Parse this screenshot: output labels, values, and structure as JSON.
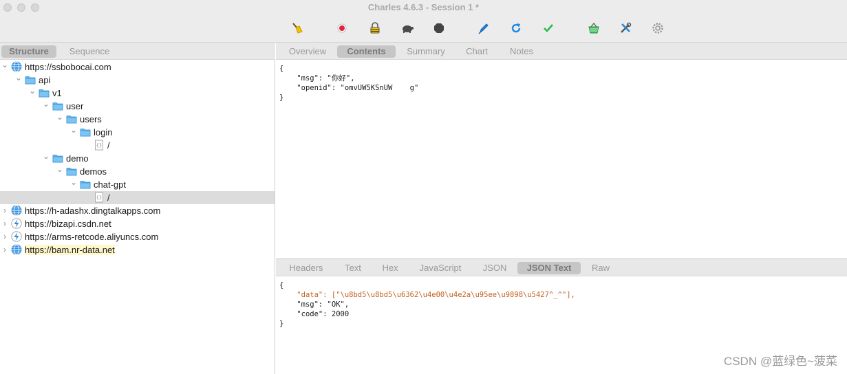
{
  "window": {
    "title": "Charles 4.6.3 - Session 1 *"
  },
  "toolbar": {
    "icons": [
      "broom-icon",
      "record-icon",
      "lock-icon",
      "turtle-icon",
      "stop-icon",
      "pen-icon",
      "refresh-icon",
      "check-icon",
      "basket-icon",
      "tools-icon",
      "settings-icon"
    ]
  },
  "left": {
    "tabs": [
      {
        "label": "Structure",
        "active": true
      },
      {
        "label": "Sequence",
        "active": false
      }
    ],
    "tree": [
      {
        "label": "https://ssbobocai.com",
        "icon": "globe-icon",
        "depth": 0,
        "chevron": "down"
      },
      {
        "label": "api",
        "icon": "folder-icon",
        "depth": 1,
        "chevron": "down"
      },
      {
        "label": "v1",
        "icon": "folder-icon",
        "depth": 2,
        "chevron": "down"
      },
      {
        "label": "user",
        "icon": "folder-icon",
        "depth": 3,
        "chevron": "down"
      },
      {
        "label": "users",
        "icon": "folder-icon",
        "depth": 4,
        "chevron": "down"
      },
      {
        "label": "login",
        "icon": "folder-icon",
        "depth": 5,
        "chevron": "down"
      },
      {
        "label": "/",
        "icon": "json-file-icon",
        "depth": 6,
        "chevron": "none"
      },
      {
        "label": "demo",
        "icon": "folder-icon",
        "depth": 3,
        "chevron": "down"
      },
      {
        "label": "demos",
        "icon": "folder-icon",
        "depth": 4,
        "chevron": "down"
      },
      {
        "label": "chat-gpt",
        "icon": "folder-icon",
        "depth": 5,
        "chevron": "down"
      },
      {
        "label": "/",
        "icon": "json-file-icon",
        "depth": 6,
        "chevron": "none",
        "selected": true
      },
      {
        "label": "https://h-adashx.dingtalkapps.com",
        "icon": "globe-icon",
        "depth": 0,
        "chevron": "right"
      },
      {
        "label": "https://bizapi.csdn.net",
        "icon": "lightning-icon",
        "depth": 0,
        "chevron": "right"
      },
      {
        "label": "https://arms-retcode.aliyuncs.com",
        "icon": "lightning-icon",
        "depth": 0,
        "chevron": "right"
      },
      {
        "label": "https://bam.nr-data.net",
        "icon": "globe-icon",
        "depth": 0,
        "chevron": "right",
        "highlight": true
      }
    ]
  },
  "request": {
    "tabs": [
      {
        "label": "Overview",
        "active": false
      },
      {
        "label": "Contents",
        "active": true
      },
      {
        "label": "Summary",
        "active": false
      },
      {
        "label": "Chart",
        "active": false
      },
      {
        "label": "Notes",
        "active": false
      }
    ],
    "lines": [
      {
        "indent": "",
        "key": "",
        "text": "{"
      },
      {
        "indent": "    ",
        "key": "",
        "text": "\"msg\": \"你好\","
      },
      {
        "indent": "    ",
        "key": "",
        "text": "\"openid\": \"omvUW5KSnUW    g\""
      },
      {
        "indent": "",
        "key": "",
        "text": "}"
      }
    ]
  },
  "response": {
    "tabs": [
      {
        "label": "Headers",
        "active": false
      },
      {
        "label": "Text",
        "active": false
      },
      {
        "label": "Hex",
        "active": false
      },
      {
        "label": "JavaScript",
        "active": false
      },
      {
        "label": "JSON",
        "active": false
      },
      {
        "label": "JSON Text",
        "active": true
      },
      {
        "label": "Raw",
        "active": false
      }
    ],
    "lines": [
      {
        "indent": "",
        "key": "",
        "text": "{"
      },
      {
        "indent": "    ",
        "key": "\"data\"",
        "text": ": [\"\\u8bd5\\u8bd5\\u6362\\u4e00\\u4e2a\\u95ee\\u9898\\u5427^_^\"],"
      },
      {
        "indent": "    ",
        "key": "",
        "text": "\"msg\": \"OK\","
      },
      {
        "indent": "    ",
        "key": "",
        "text": "\"code\": 2000"
      },
      {
        "indent": "",
        "key": "",
        "text": "}"
      }
    ]
  },
  "watermark": "CSDN @蓝绿色~菠菜"
}
